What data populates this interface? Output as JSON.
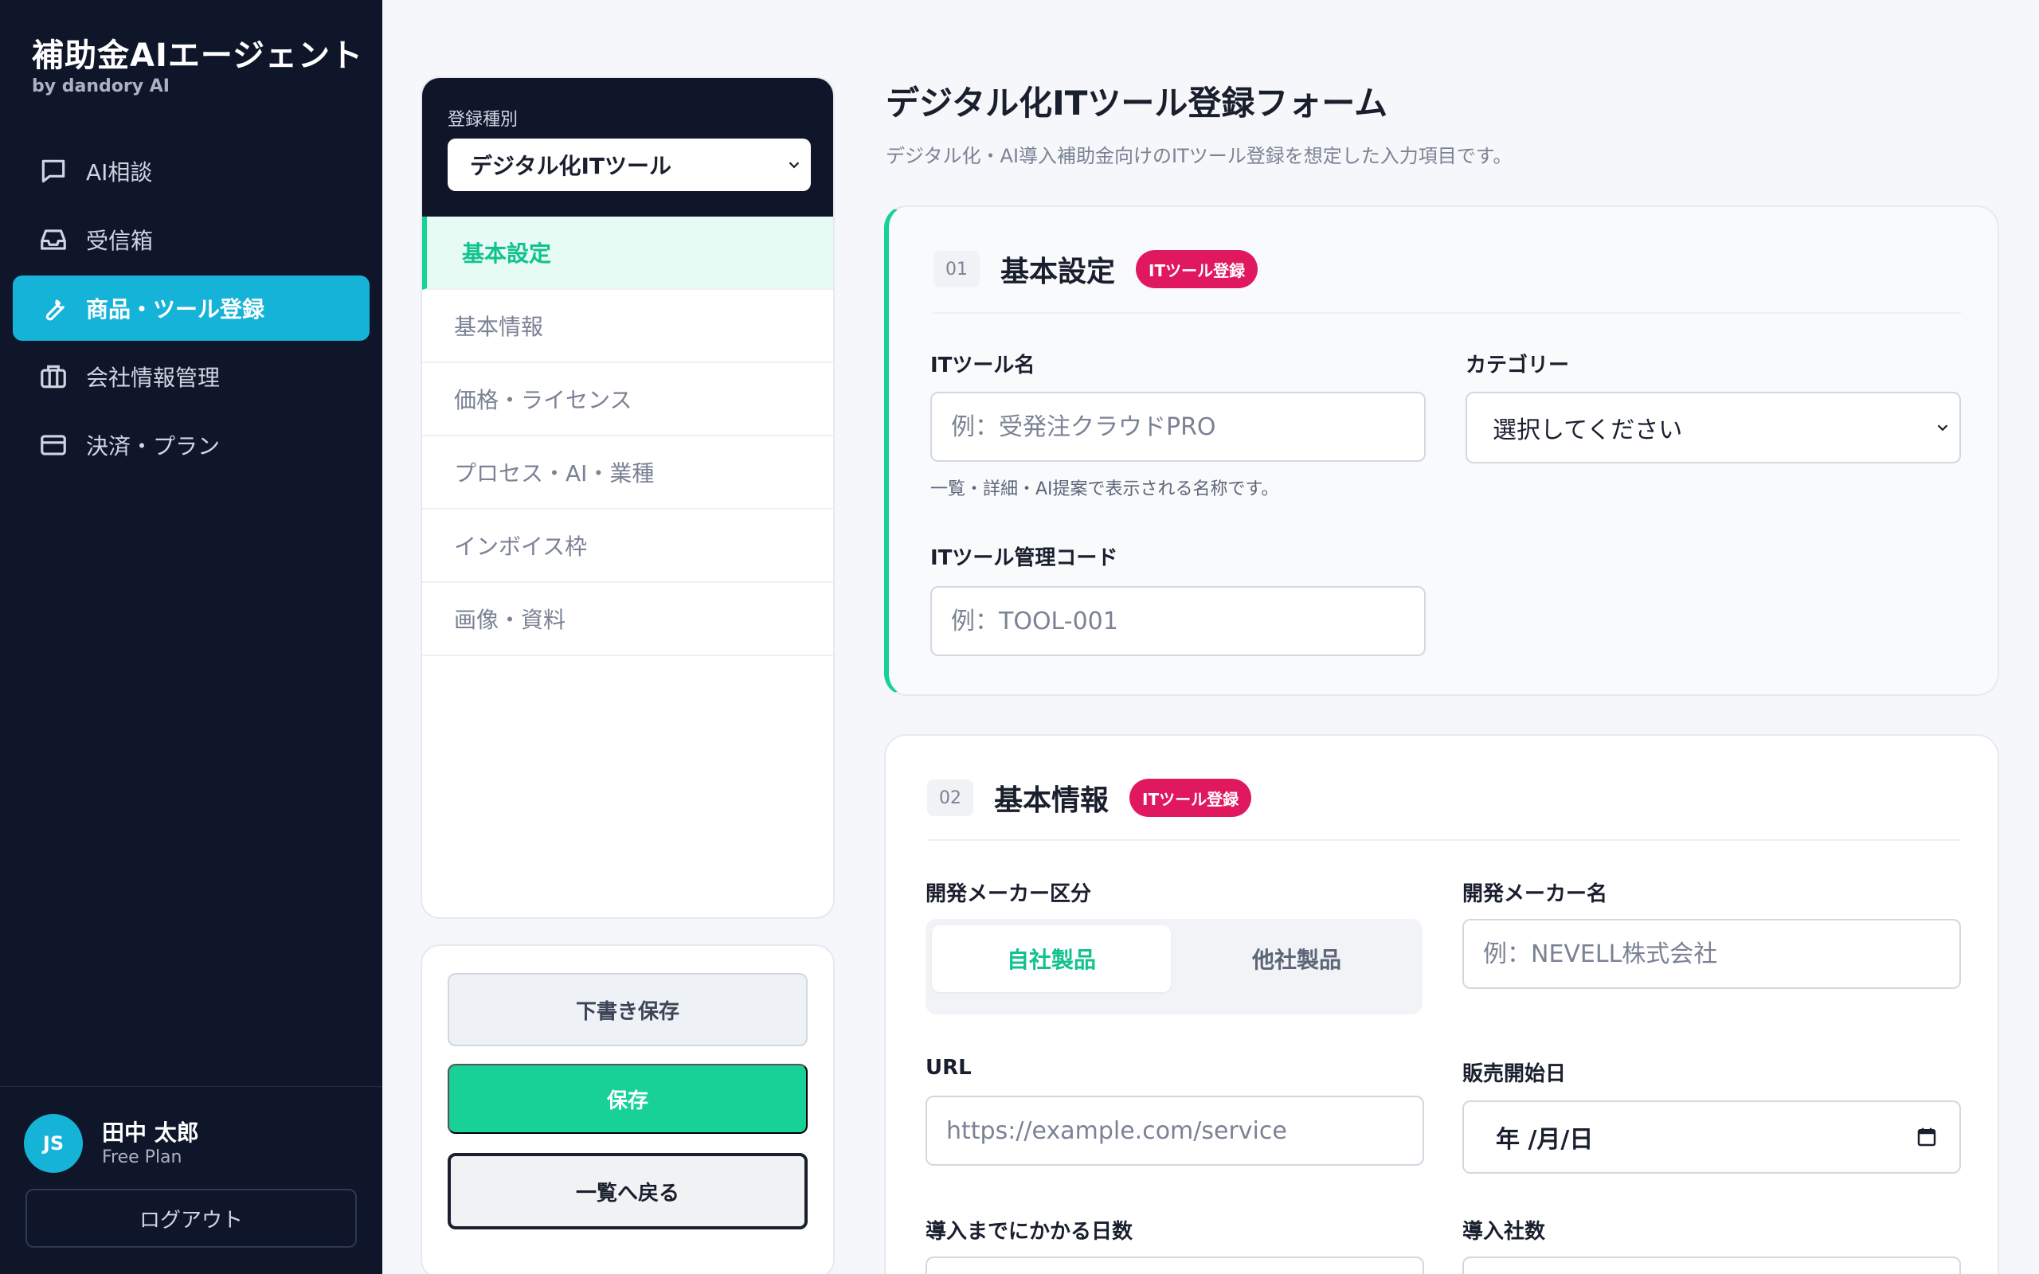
{
  "brand": {
    "title": "補助金AIエージェント",
    "subtitle": "by dandory AI"
  },
  "nav": [
    {
      "label": "AI相談",
      "icon": "chat-icon"
    },
    {
      "label": "受信箱",
      "icon": "inbox-icon"
    },
    {
      "label": "商品・ツール登録",
      "icon": "wrench-icon",
      "active": true
    },
    {
      "label": "会社情報管理",
      "icon": "briefcase-icon"
    },
    {
      "label": "決済・プラン",
      "icon": "credit-card-icon"
    }
  ],
  "user": {
    "initials": "JS",
    "name": "田中 太郎",
    "plan": "Free Plan",
    "logout": "ログアウト"
  },
  "sections_panel": {
    "type_label": "登録種別",
    "type_value": "デジタル化ITツール",
    "items": [
      "基本設定",
      "基本情報",
      "価格・ライセンス",
      "プロセス・AI・業種",
      "インボイス枠",
      "画像・資料"
    ]
  },
  "actions": {
    "draft": "下書き保存",
    "save": "保存",
    "back": "一覧へ戻る"
  },
  "page": {
    "title": "デジタル化ITツール登録フォーム",
    "description": "デジタル化・AI導入補助金向けのITツール登録を想定した入力項目です。"
  },
  "card1": {
    "number": "01",
    "title": "基本設定",
    "tag": "ITツール登録",
    "tool_name_label": "ITツール名",
    "tool_name_placeholder": "例：受発注クラウドPRO",
    "tool_name_hint": "一覧・詳細・AI提案で表示される名称です。",
    "category_label": "カテゴリー",
    "category_value": "選択してください",
    "code_label": "ITツール管理コード",
    "code_placeholder": "例：TOOL-001"
  },
  "card2": {
    "number": "02",
    "title": "基本情報",
    "tag": "ITツール登録",
    "maker_type_label": "開発メーカー区分",
    "maker_type_options": [
      "自社製品",
      "他社製品"
    ],
    "maker_name_label": "開発メーカー名",
    "maker_name_placeholder": "例：NEVELL株式会社",
    "url_label": "URL",
    "url_placeholder": "https://example.com/service",
    "release_date_label": "販売開始日",
    "release_date_value": "年 /月/日",
    "lead_days_label": "導入までにかかる日数",
    "companies_label": "導入社数"
  },
  "colors": {
    "sidebar": "#0f1629",
    "accent_cyan": "#16b3d9",
    "accent_green": "#18d196",
    "tag_pink": "#e0195e"
  }
}
